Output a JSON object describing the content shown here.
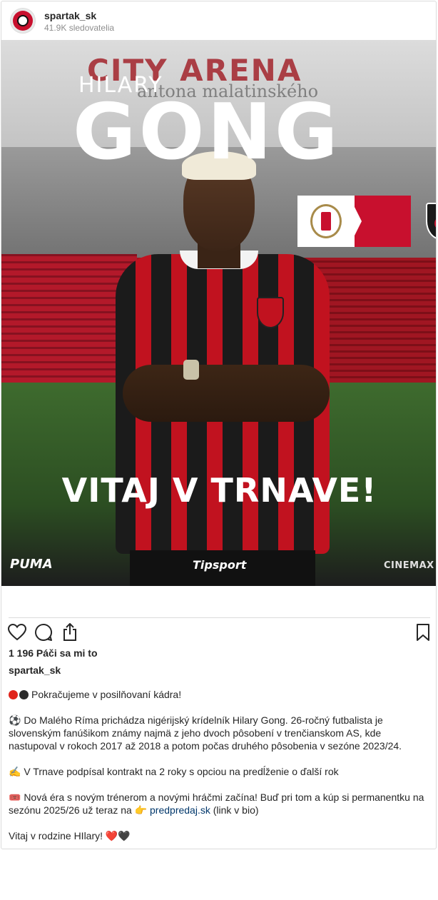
{
  "post": {
    "username": "spartak_sk",
    "followers": "41.9K sledovatelia",
    "likes": "1 196 Páči sa mi to",
    "caption_user": "spartak_sk"
  },
  "media": {
    "arena_text": "CITY ARENA",
    "arena_sub": "antona malatinského",
    "player_first_name": "HILARY",
    "player_last_name": "GONG",
    "headline": "VITAJ V TRNAVE!",
    "sponsors": {
      "left": "PUMA",
      "center": "Tipsport",
      "right": "CINEMAX"
    }
  },
  "caption": {
    "line1": "Pokračujeme v posilňovaní kádra!",
    "line2": "⚽ Do Malého Ríma prichádza nigérijský krídelník Hilary Gong. 26-ročný futbalista je slovenským fanúšikom známy najmä z jeho dvoch pôsobení v trenčianskom AS, kde nastupoval v rokoch 2017 až 2018 a potom počas druhého pôsobenia v sezóne 2023/24.",
    "line3": "✍️ V Trnave podpísal kontrakt na 2 roky s opciou na predĺženie o ďalší rok",
    "line4_before": "🎟️ Nová éra s novým trénerom a novými hráčmi začína! Buď pri tom a kúp si permanentku na sezónu 2025/26 už teraz na 👉 ",
    "line4_link": "predpredaj.sk",
    "line4_after": " (link v bio)",
    "line5": "Vitaj v rodzine HIlary! ❤️🖤"
  },
  "icons": {
    "like": "heart-icon",
    "comment": "comment-icon",
    "share": "share-icon",
    "save": "bookmark-icon"
  },
  "colors": {
    "club_red": "#c8102e",
    "link": "#00376b",
    "text": "#262626",
    "muted": "#8e8e8e"
  }
}
